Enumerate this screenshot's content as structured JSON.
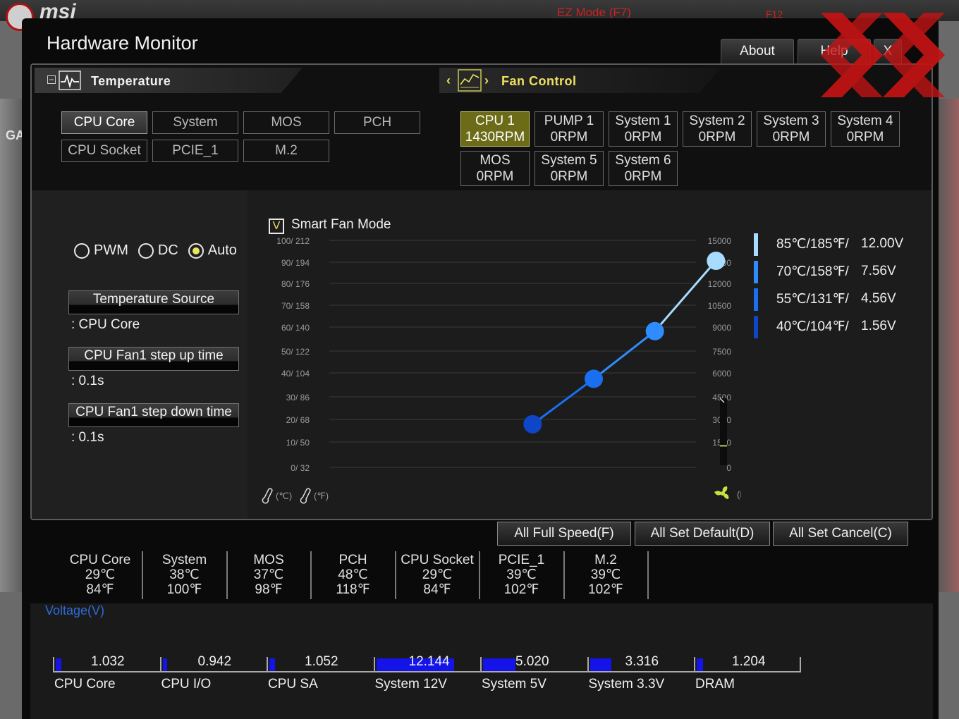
{
  "background": {
    "brand": "msi",
    "ez_mode": "EZ Mode (F7)",
    "f12": "F12",
    "side_label": "GA"
  },
  "window": {
    "title": "Hardware Monitor",
    "about": "About",
    "help": "Help",
    "close": "X"
  },
  "tabs": {
    "temperature": "Temperature",
    "fan_control": "Fan Control",
    "prev": "‹",
    "next": "›"
  },
  "temp_sources": [
    {
      "label": "CPU Core",
      "active": true
    },
    {
      "label": "System",
      "active": false
    },
    {
      "label": "MOS",
      "active": false
    },
    {
      "label": "PCH",
      "active": false
    },
    {
      "label": "CPU Socket",
      "active": false
    },
    {
      "label": "PCIE_1",
      "active": false
    },
    {
      "label": "M.2",
      "active": false
    }
  ],
  "fans": [
    {
      "name": "CPU 1",
      "rpm": "1430RPM",
      "active": true
    },
    {
      "name": "PUMP 1",
      "rpm": "0RPM",
      "active": false
    },
    {
      "name": "System 1",
      "rpm": "0RPM",
      "active": false
    },
    {
      "name": "System 2",
      "rpm": "0RPM",
      "active": false
    },
    {
      "name": "System 3",
      "rpm": "0RPM",
      "active": false
    },
    {
      "name": "System 4",
      "rpm": "0RPM",
      "active": false
    },
    {
      "name": "MOS",
      "rpm": "0RPM",
      "active": false
    },
    {
      "name": "System 5",
      "rpm": "0RPM",
      "active": false
    },
    {
      "name": "System 6",
      "rpm": "0RPM",
      "active": false
    }
  ],
  "mode": {
    "options": [
      "PWM",
      "DC",
      "Auto"
    ],
    "selected": "Auto"
  },
  "settings": {
    "temp_source_label": "Temperature Source",
    "temp_source_value": ": CPU Core",
    "step_up_label": "CPU Fan1 step up time",
    "step_up_value": ": 0.1s",
    "step_down_label": "CPU Fan1 step down time",
    "step_down_value": ": 0.1s"
  },
  "smart_fan": {
    "label": "Smart Fan Mode",
    "checked": true,
    "check_mark": "V"
  },
  "chart_data": {
    "type": "line",
    "y_left_ticks": [
      "100/ 212",
      "90/ 194",
      "80/ 176",
      "70/ 158",
      "60/ 140",
      "50/ 122",
      "40/ 104",
      "30/  86",
      "20/  68",
      "10/  50",
      "0/  32"
    ],
    "y_right_ticks": [
      "15000",
      "13500",
      "12000",
      "10500",
      "9000",
      "7500",
      "6000",
      "4500",
      "3000",
      "1500",
      "0"
    ],
    "x_unit_c": "(℃)",
    "x_unit_f": "(℉)",
    "rpm_unit": "(RPM)",
    "current_rpm_level": 0.29,
    "series": [
      {
        "points": [
          {
            "temp_c": 40,
            "percent": 19,
            "color": "#0f46c8"
          },
          {
            "temp_c": 55,
            "percent": 39,
            "color": "#1a6ff0"
          },
          {
            "temp_c": 70,
            "percent": 60,
            "color": "#2e8cff"
          },
          {
            "temp_c": 85,
            "percent": 91,
            "color": "#a8dcff"
          }
        ]
      }
    ],
    "x_range": [
      10,
      100
    ],
    "y_range": [
      0,
      100
    ]
  },
  "voltage_legend": [
    {
      "temp": "85℃/185℉/",
      "volt": "12.00V",
      "color": "#a8dcff"
    },
    {
      "temp": "70℃/158℉/",
      "volt": "7.56V",
      "color": "#2e8cff"
    },
    {
      "temp": "55℃/131℉/",
      "volt": "4.56V",
      "color": "#1a6ff0"
    },
    {
      "temp": "40℃/104℉/",
      "volt": "1.56V",
      "color": "#0f46c8"
    }
  ],
  "actions": {
    "full_speed": "All Full Speed(F)",
    "set_default": "All Set Default(D)",
    "set_cancel": "All Set Cancel(C)"
  },
  "temperatures": [
    {
      "name": "CPU Core",
      "c": "29℃",
      "f": "84℉"
    },
    {
      "name": "System",
      "c": "38℃",
      "f": "100℉"
    },
    {
      "name": "MOS",
      "c": "37℃",
      "f": "98℉"
    },
    {
      "name": "PCH",
      "c": "48℃",
      "f": "118℉"
    },
    {
      "name": "CPU Socket",
      "c": "29℃",
      "f": "84℉"
    },
    {
      "name": "PCIE_1",
      "c": "39℃",
      "f": "102℉"
    },
    {
      "name": "M.2",
      "c": "39℃",
      "f": "102℉"
    }
  ],
  "voltage": {
    "title": "Voltage(V)",
    "items": [
      {
        "name": "CPU Core",
        "value": "1.032",
        "level": 0.06
      },
      {
        "name": "CPU I/O",
        "value": "0.942",
        "level": 0.05
      },
      {
        "name": "CPU SA",
        "value": "1.052",
        "level": 0.06
      },
      {
        "name": "System 12V",
        "value": "12.144",
        "level": 0.86
      },
      {
        "name": "System 5V",
        "value": "5.020",
        "level": 0.36
      },
      {
        "name": "System 3.3V",
        "value": "3.316",
        "level": 0.24
      },
      {
        "name": "DRAM",
        "value": "1.204",
        "level": 0.07
      }
    ]
  }
}
